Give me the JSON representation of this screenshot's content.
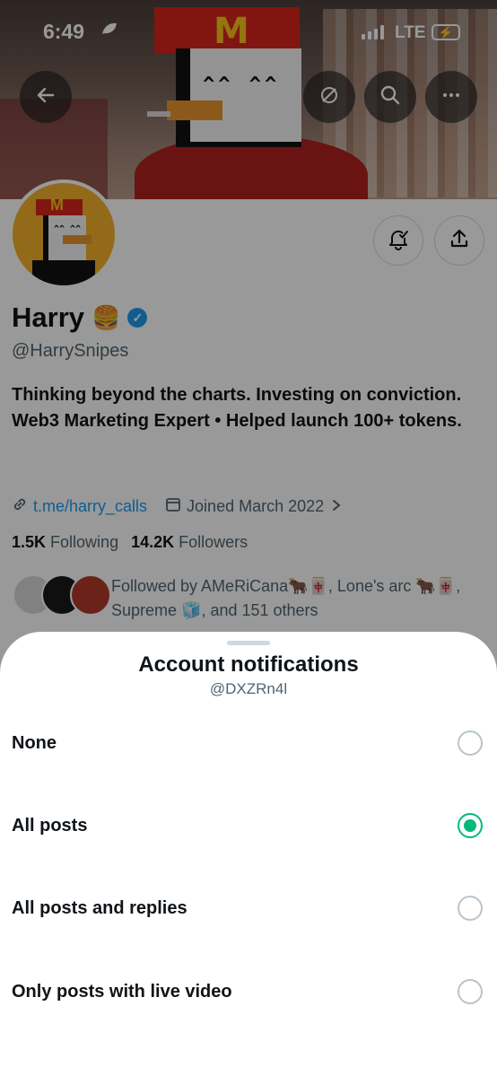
{
  "status_bar": {
    "time": "6:49",
    "network": "LTE"
  },
  "profile": {
    "name": "Harry",
    "name_emoji": "🍔",
    "handle": "@HarrySnipes",
    "bio_line1": "Thinking beyond the charts. Investing on conviction.",
    "bio_line2": "Web3 Marketing Expert • Helped launch 100+ tokens.",
    "link": "t.me/harry_calls",
    "joined": "Joined March 2022",
    "following_count": "1.5K",
    "following_label": "Following",
    "followers_count": "14.2K",
    "followers_label": "Followers",
    "followed_by": "Followed by AMeRiCana🐂🀄, Lone's arc 🐂🀄, Supreme 🧊, and 151 others"
  },
  "icons": {
    "back": "arrow-left-icon",
    "hide": "eye-slash-icon",
    "search": "search-icon",
    "more": "more-horizontal-icon",
    "notify": "bell-check-icon",
    "share": "share-icon"
  },
  "sheet": {
    "title": "Account notifications",
    "subtitle": "@DXZRn4l",
    "options": [
      {
        "label": "None",
        "selected": false
      },
      {
        "label": "All posts",
        "selected": true
      },
      {
        "label": "All posts and replies",
        "selected": false
      },
      {
        "label": "Only posts with live video",
        "selected": false
      }
    ]
  },
  "colors": {
    "accent": "#1d9bf0",
    "selected": "#00ba7c",
    "brand_red": "#d7261d",
    "brand_yellow": "#f3b12b"
  }
}
